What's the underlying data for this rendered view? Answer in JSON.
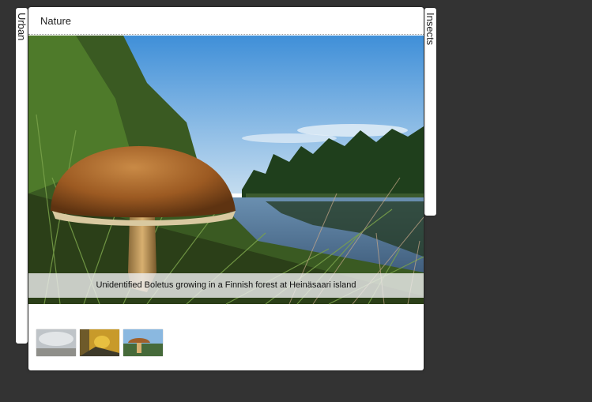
{
  "tabs": {
    "left": {
      "label": "Urban"
    },
    "right": {
      "label": "Insects"
    }
  },
  "gallery": {
    "title": "Nature",
    "caption": "Unidentified Boletus growing in a Finnish forest at Heinäsaari island",
    "thumbnails": [
      {
        "subject": "misty-landscape"
      },
      {
        "subject": "yellow-insect"
      },
      {
        "subject": "mushroom"
      }
    ]
  },
  "colors": {
    "page_background": "#333333",
    "panel_background": "#ffffff",
    "caption_background": "#ebebeb"
  }
}
